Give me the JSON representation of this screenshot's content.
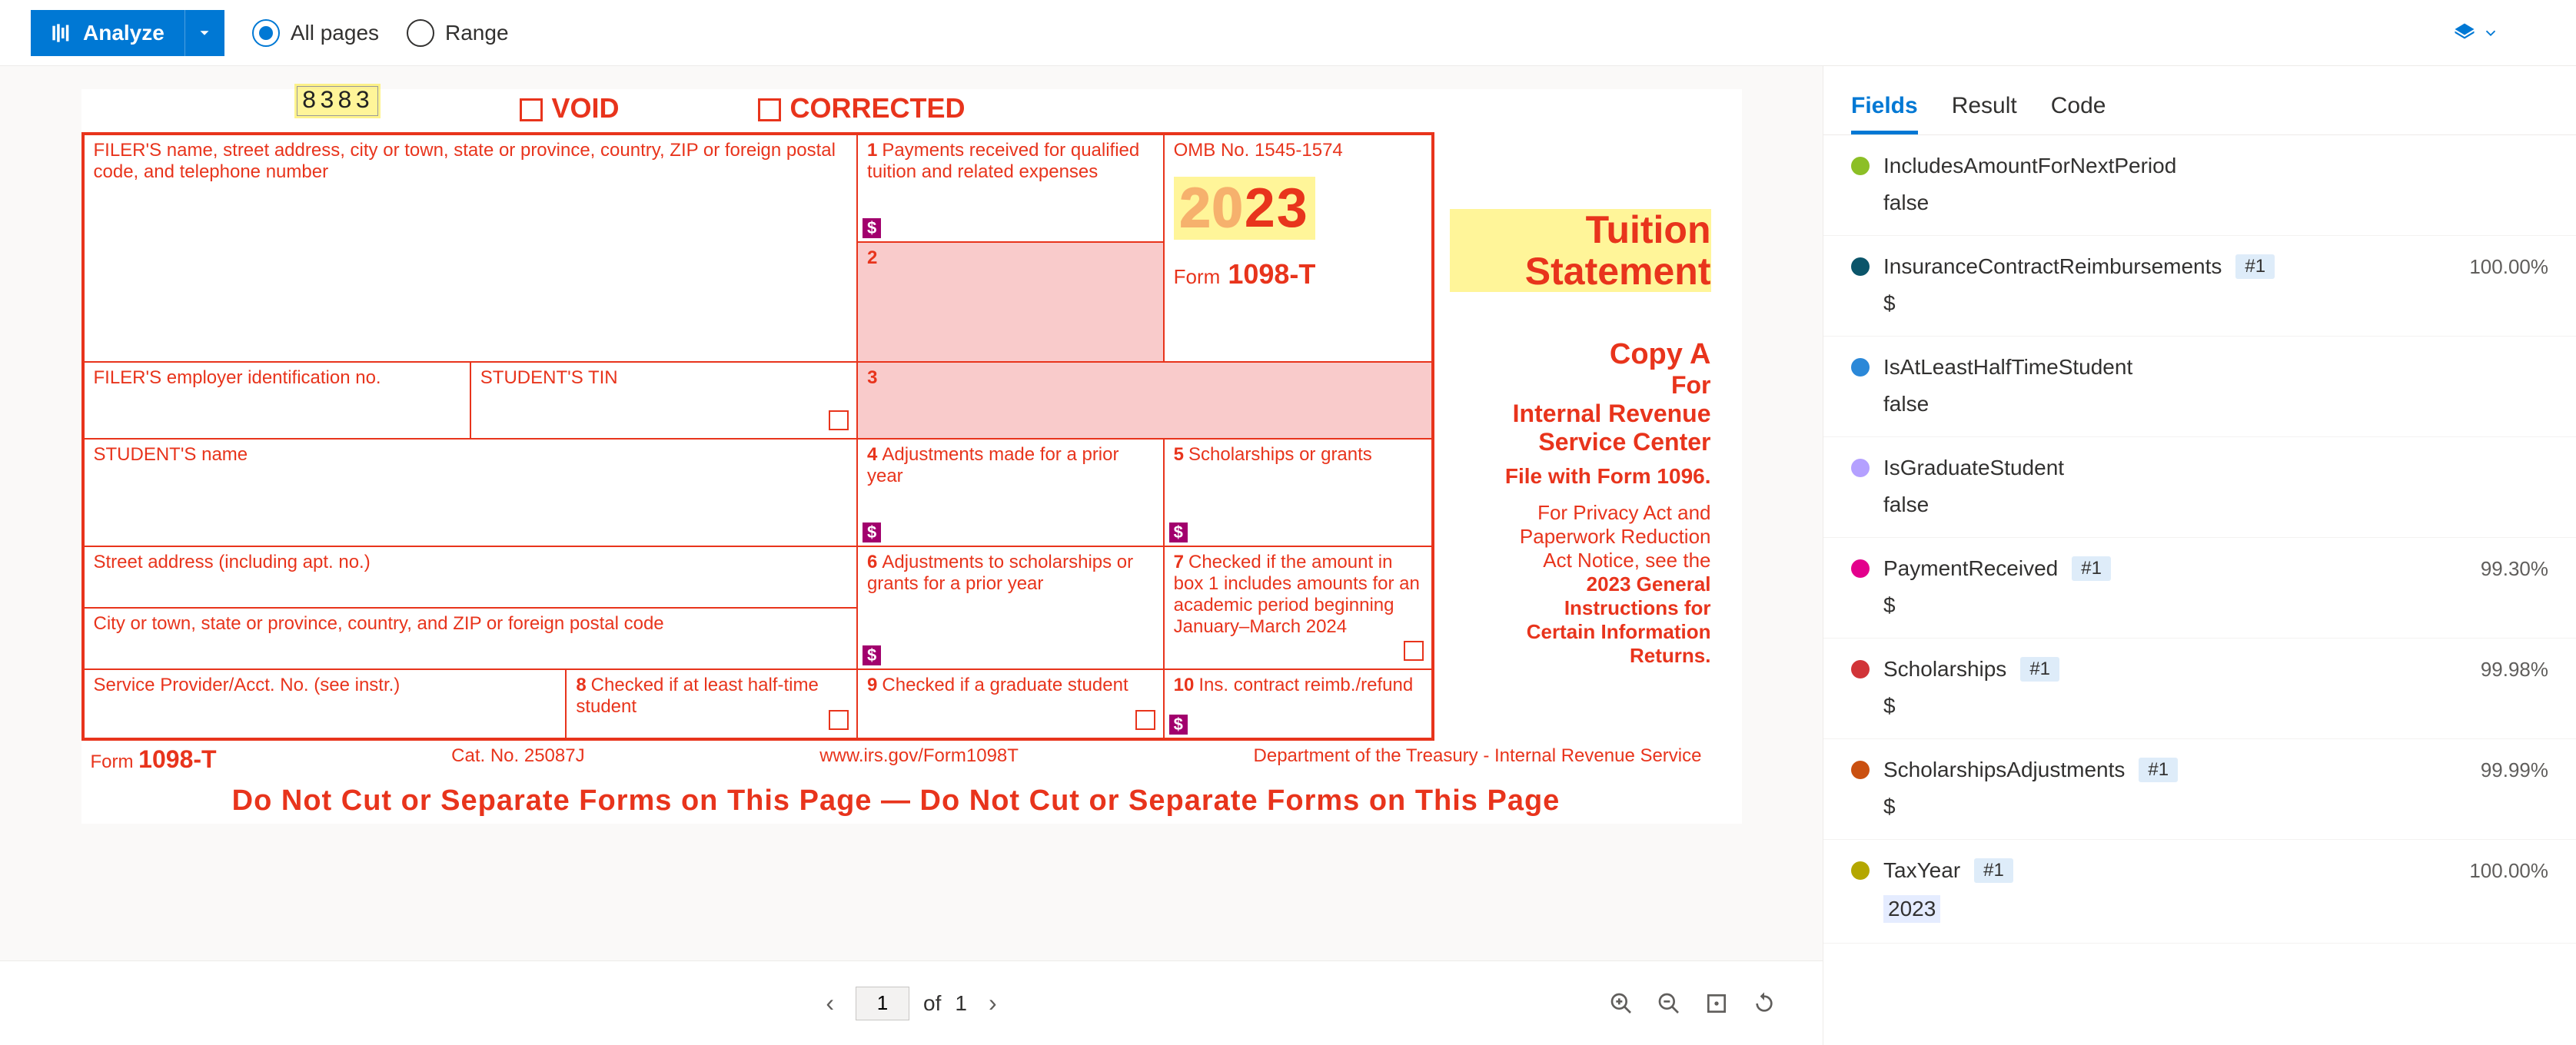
{
  "toolbar": {
    "analyze_label": "Analyze",
    "all_pages_label": "All pages",
    "range_label": "Range",
    "selected_scope": "all"
  },
  "pager": {
    "current": "1",
    "of_label": "of",
    "total": "1"
  },
  "side": {
    "tabs": {
      "fields": "Fields",
      "result": "Result",
      "code": "Code"
    },
    "active_tab": "fields",
    "fields": [
      {
        "name": "IncludesAmountForNextPeriod",
        "value": "false",
        "color": "#8cbf26",
        "badge": null,
        "confidence": null
      },
      {
        "name": "InsuranceContractReimbursements",
        "value": "$",
        "color": "#0b556a",
        "badge": "#1",
        "confidence": "100.00%"
      },
      {
        "name": "IsAtLeastHalfTimeStudent",
        "value": "false",
        "color": "#2b88d8",
        "badge": null,
        "confidence": null
      },
      {
        "name": "IsGraduateStudent",
        "value": "false",
        "color": "#b4a0ff",
        "badge": null,
        "confidence": null
      },
      {
        "name": "PaymentReceived",
        "value": "$",
        "color": "#e3008c",
        "badge": "#1",
        "confidence": "99.30%"
      },
      {
        "name": "Scholarships",
        "value": "$",
        "color": "#d13438",
        "badge": "#1",
        "confidence": "99.98%"
      },
      {
        "name": "ScholarshipsAdjustments",
        "value": "$",
        "color": "#ca5010",
        "badge": "#1",
        "confidence": "99.99%"
      },
      {
        "name": "TaxYear",
        "value": "2023",
        "color": "#b4a700",
        "badge": "#1",
        "confidence": "100.00%"
      }
    ]
  },
  "form": {
    "control_number": "8383",
    "void_label": "VOID",
    "corrected_label": "CORRECTED",
    "filer_label": "FILER'S name, street address, city or town, state or province, country, ZIP or foreign postal code, and telephone number",
    "box1_label": "Payments received for qualified tuition and related expenses",
    "omb_label": "OMB No. 1545-1574",
    "year_20": "20",
    "year_23": "23",
    "form_label": "Form",
    "form_num": "1098-T",
    "title_line1": "Tuition",
    "title_line2": "Statement",
    "filer_ein_label": "FILER'S employer identification no.",
    "student_tin_label": "STUDENT'S TIN",
    "student_name_label": "STUDENT'S name",
    "box4_label": "Adjustments made for a prior year",
    "box5_label": "Scholarships or grants",
    "street_label": "Street address (including apt. no.)",
    "box6_label": "Adjustments to scholarships or grants for a prior year",
    "box7_label": "Checked if the amount in box 1 includes amounts for an academic period beginning January–March 2024",
    "city_label": "City or town, state or province, country, and ZIP or foreign postal code",
    "provider_label": "Service Provider/Acct. No. (see instr.)",
    "box8_label": "Checked if at least half-time student",
    "box9_label": "Checked if a graduate student",
    "box10_label": "Ins. contract reimb./refund",
    "copy_a": "Copy A",
    "for": "For",
    "irs_line1": "Internal Revenue",
    "irs_line2": "Service Center",
    "file_with": "File with Form 1096.",
    "privacy1": "For Privacy Act and",
    "privacy2": "Paperwork Reduction",
    "privacy3": "Act Notice, see the",
    "privacy4": "2023 General",
    "privacy5": "Instructions for",
    "privacy6": "Certain Information",
    "privacy7": "Returns.",
    "footer_form": "Form",
    "footer_formnum": "1098-T",
    "cat_no": "Cat. No. 25087J",
    "url": "www.irs.gov/Form1098T",
    "dept": "Department of the Treasury - Internal Revenue Service",
    "donotcut": "Do Not Cut or Separate Forms on This Page   —   Do Not Cut or Separate Forms on This Page"
  }
}
